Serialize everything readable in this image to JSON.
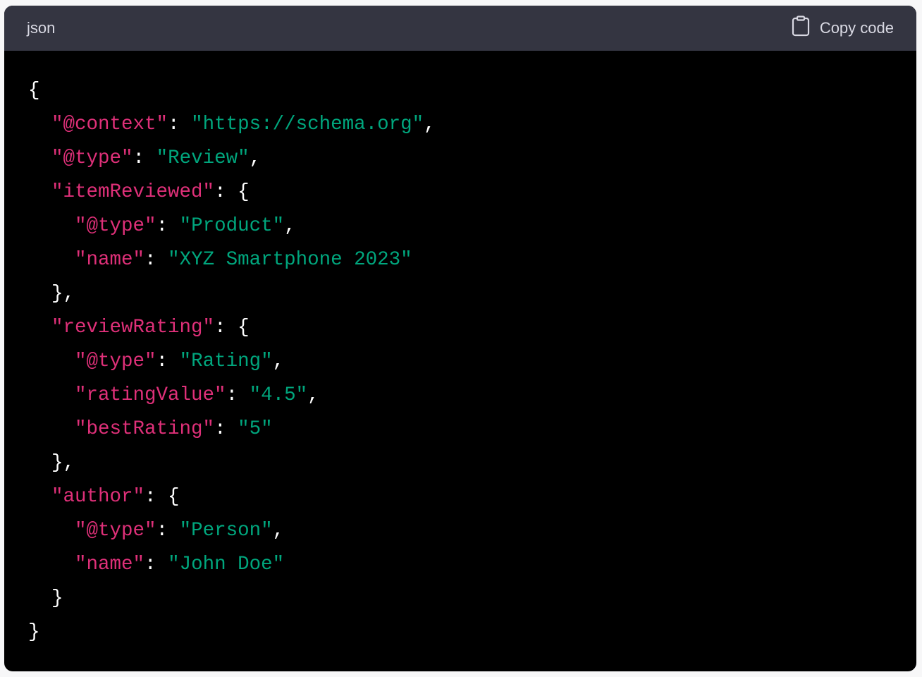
{
  "header": {
    "language": "json",
    "copy_label": "Copy code",
    "copy_icon": "clipboard-icon"
  },
  "colors": {
    "key": "#df3079",
    "string": "#00a67d",
    "punct": "#ffffff",
    "header_bg": "#343541"
  },
  "lines": [
    [
      [
        "p",
        "{"
      ]
    ],
    [
      [
        "p",
        "  "
      ],
      [
        "k",
        "\"@context\""
      ],
      [
        "p",
        ": "
      ],
      [
        "s",
        "\"https://schema.org\""
      ],
      [
        "p",
        ","
      ]
    ],
    [
      [
        "p",
        "  "
      ],
      [
        "k",
        "\"@type\""
      ],
      [
        "p",
        ": "
      ],
      [
        "s",
        "\"Review\""
      ],
      [
        "p",
        ","
      ]
    ],
    [
      [
        "p",
        "  "
      ],
      [
        "k",
        "\"itemReviewed\""
      ],
      [
        "p",
        ": {"
      ]
    ],
    [
      [
        "p",
        "    "
      ],
      [
        "k",
        "\"@type\""
      ],
      [
        "p",
        ": "
      ],
      [
        "s",
        "\"Product\""
      ],
      [
        "p",
        ","
      ]
    ],
    [
      [
        "p",
        "    "
      ],
      [
        "k",
        "\"name\""
      ],
      [
        "p",
        ": "
      ],
      [
        "s",
        "\"XYZ Smartphone 2023\""
      ]
    ],
    [
      [
        "p",
        "  },"
      ]
    ],
    [
      [
        "p",
        "  "
      ],
      [
        "k",
        "\"reviewRating\""
      ],
      [
        "p",
        ": {"
      ]
    ],
    [
      [
        "p",
        "    "
      ],
      [
        "k",
        "\"@type\""
      ],
      [
        "p",
        ": "
      ],
      [
        "s",
        "\"Rating\""
      ],
      [
        "p",
        ","
      ]
    ],
    [
      [
        "p",
        "    "
      ],
      [
        "k",
        "\"ratingValue\""
      ],
      [
        "p",
        ": "
      ],
      [
        "s",
        "\"4.5\""
      ],
      [
        "p",
        ","
      ]
    ],
    [
      [
        "p",
        "    "
      ],
      [
        "k",
        "\"bestRating\""
      ],
      [
        "p",
        ": "
      ],
      [
        "s",
        "\"5\""
      ]
    ],
    [
      [
        "p",
        "  },"
      ]
    ],
    [
      [
        "p",
        "  "
      ],
      [
        "k",
        "\"author\""
      ],
      [
        "p",
        ": {"
      ]
    ],
    [
      [
        "p",
        "    "
      ],
      [
        "k",
        "\"@type\""
      ],
      [
        "p",
        ": "
      ],
      [
        "s",
        "\"Person\""
      ],
      [
        "p",
        ","
      ]
    ],
    [
      [
        "p",
        "    "
      ],
      [
        "k",
        "\"name\""
      ],
      [
        "p",
        ": "
      ],
      [
        "s",
        "\"John Doe\""
      ]
    ],
    [
      [
        "p",
        "  }"
      ]
    ],
    [
      [
        "p",
        "}"
      ]
    ]
  ]
}
